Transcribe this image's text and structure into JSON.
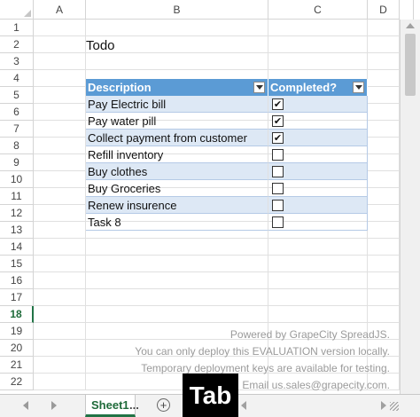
{
  "columns": [
    "A",
    "B",
    "C",
    "D"
  ],
  "rows": [
    "1",
    "2",
    "3",
    "4",
    "5",
    "6",
    "7",
    "8",
    "9",
    "10",
    "11",
    "12",
    "13",
    "14",
    "15",
    "16",
    "17",
    "18",
    "19",
    "20",
    "21",
    "22"
  ],
  "active_row": "18",
  "sheet_title": "Todo",
  "table": {
    "headers": [
      "Description",
      "Completed?"
    ],
    "items": [
      {
        "description": "Pay Electric bill",
        "completed": true
      },
      {
        "description": "Pay water pill",
        "completed": true
      },
      {
        "description": "Collect payment from customer",
        "completed": true
      },
      {
        "description": "Refill inventory",
        "completed": false
      },
      {
        "description": "Buy clothes",
        "completed": false
      },
      {
        "description": "Buy Groceries",
        "completed": false
      },
      {
        "description": "Renew insurence",
        "completed": false
      },
      {
        "description": "Task 8",
        "completed": false
      }
    ]
  },
  "watermark": [
    "Powered by GrapeCity SpreadJS.",
    "You can only deploy this EVALUATION version locally.",
    "Temporary deployment keys are available for testing.",
    "Email us.sales@grapecity.com."
  ],
  "tabs": {
    "sheet_tab": "Sheet1",
    "more": "...",
    "add": "+",
    "overlay_label": "Tab"
  },
  "colors": {
    "header_blue": "#5b9bd5",
    "band_blue": "#dde8f5",
    "active_green": "#217346"
  }
}
